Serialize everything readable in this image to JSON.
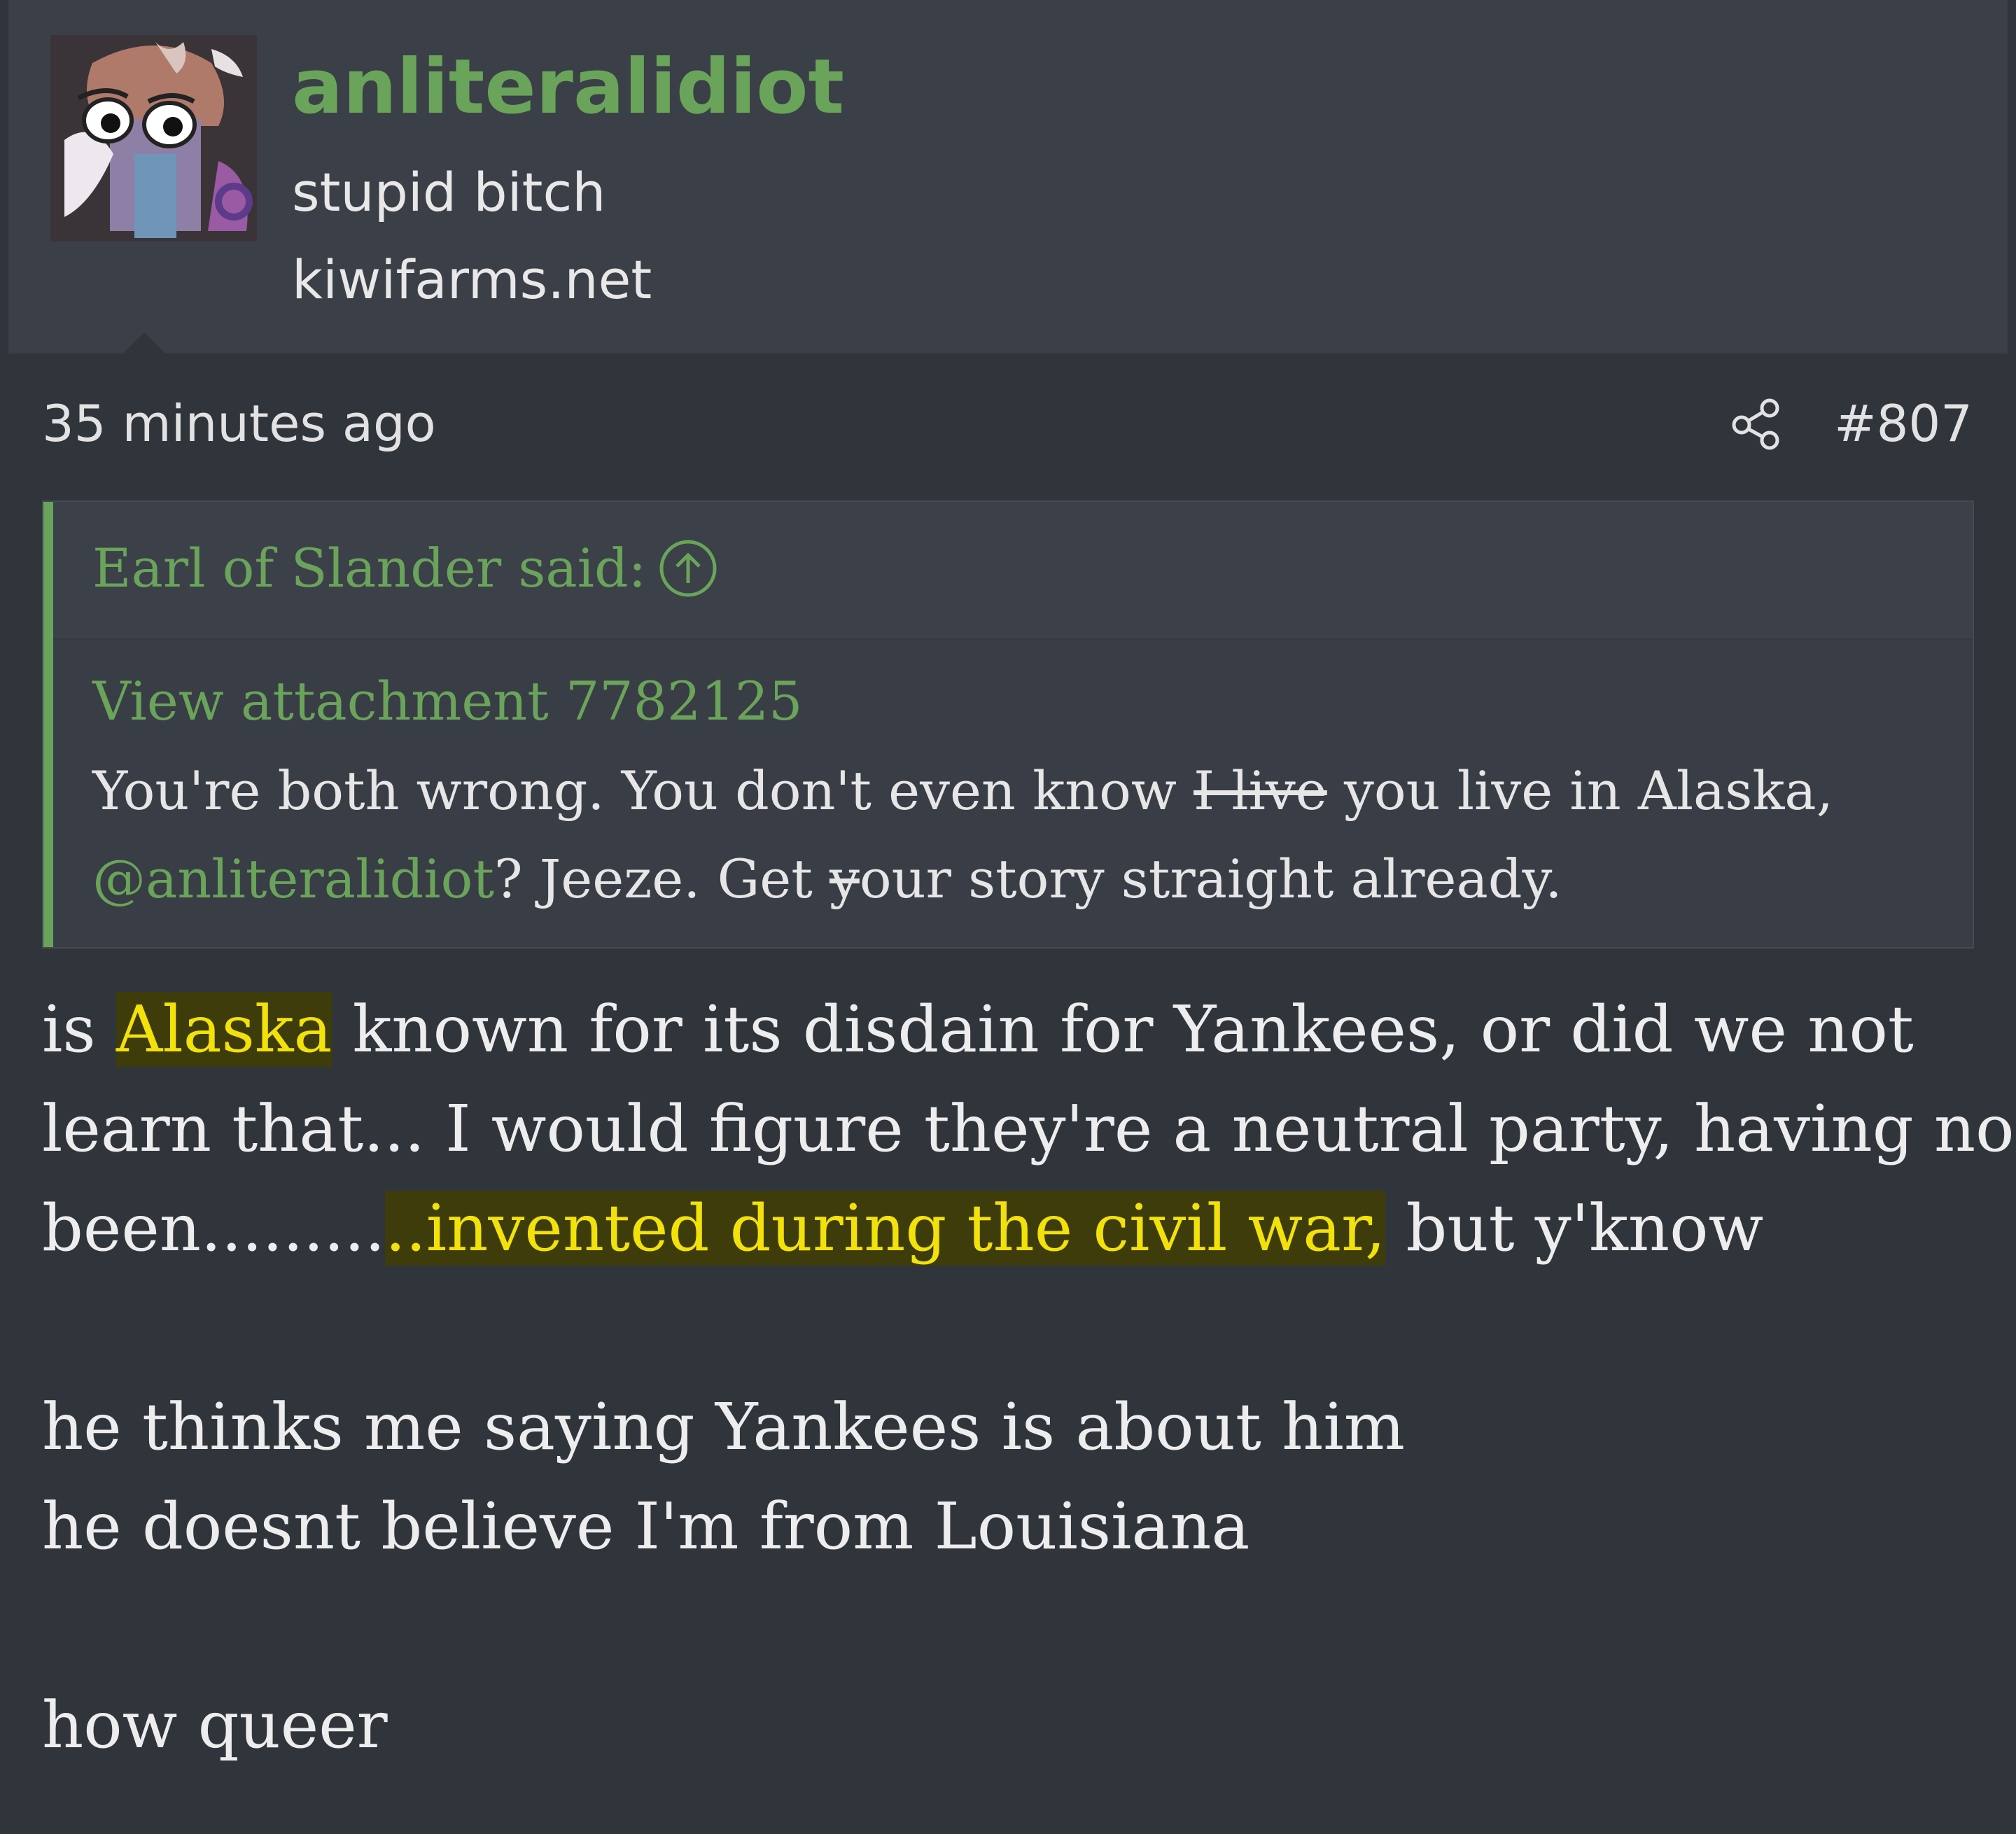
{
  "user": {
    "username": "anliteralidiot",
    "title": "stupid bitch",
    "site": "kiwifarms.net"
  },
  "meta": {
    "timestamp": "35 minutes ago",
    "post_number": "#807",
    "share_icon": "share-icon"
  },
  "quote": {
    "author_said": "Earl of Slander said:",
    "jump_icon": "arrow-up-circle-icon",
    "attachment": "View attachment 7782125",
    "line1_a": "You're both wrong. You don't even know ",
    "line1_strike": "I live",
    "line1_b": " you live in Alaska,",
    "mention": "@anliteralidiot",
    "line2_a": "? Jeeze. Get ",
    "line2_strike": "y",
    "line2_b": "our story straight already."
  },
  "body": {
    "p1_a": "is ",
    "p1_hl": "Alaska",
    "p1_b": " known for its disdain for Yankees, or did we not",
    "p2": "learn that... I would figure they're a neutral party, having not",
    "p3_a": "been.........",
    "p3_hl": "..invented during the civil war,",
    "p3_b": " but y'know",
    "p4": "he thinks me saying Yankees is about him",
    "p5": "he doesnt believe I'm from Louisiana",
    "p6": "how queer"
  },
  "colors": {
    "accent": "#6aa45a",
    "highlight_text": "#f2e20a",
    "highlight_bg": "#3f3c0b",
    "background": "#30343b"
  }
}
